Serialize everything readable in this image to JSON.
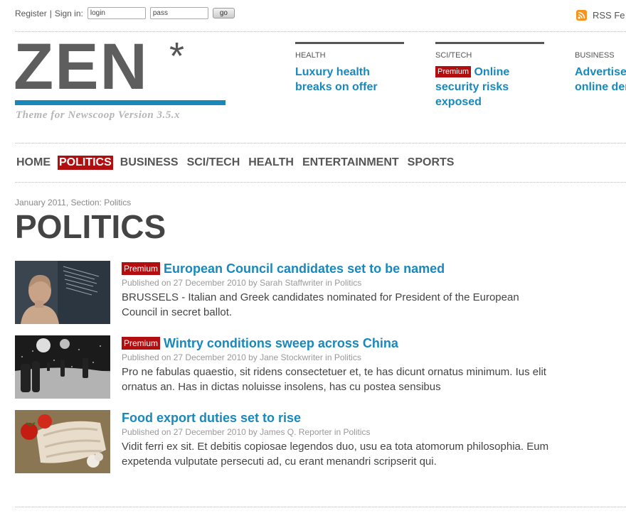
{
  "topbar": {
    "register": "Register",
    "separator": "|",
    "signin": "Sign in:",
    "login_value": "login",
    "pass_value": "pass",
    "go": "go",
    "rss": "RSS Fe"
  },
  "logo": {
    "text": "ZEN",
    "star": "*",
    "tagline": "Theme for Newscoop Version 3.5.x"
  },
  "featured": [
    {
      "section": "HEALTH",
      "badge": "",
      "title": "Luxury health breaks on offer"
    },
    {
      "section": "SCI/TECH",
      "badge": "Premium",
      "title": "Online security risks exposed"
    },
    {
      "section": "BUSINESS",
      "badge": "",
      "title": "Advertise online der"
    }
  ],
  "nav": {
    "items": [
      "HOME",
      "POLITICS",
      "BUSINESS",
      "SCI/TECH",
      "HEALTH",
      "ENTERTAINMENT",
      "SPORTS"
    ],
    "active": "POLITICS"
  },
  "section": {
    "meta": "January 2011, Section: Politics",
    "title": "POLITICS"
  },
  "articles": [
    {
      "badge": "Premium",
      "title": "European Council candidates set to be named",
      "meta": "Published on 27 December 2010 by Sarah Staffwriter in Politics",
      "text": "BRUSSELS - Italian and Greek candidates nominated for President of the European Council in secret ballot."
    },
    {
      "badge": "Premium",
      "title": "Wintry conditions sweep across China",
      "meta": "Published on 27 December 2010 by Jane Stockwriter in Politics",
      "text": "Pro ne fabulas quaestio, sit ridens consectetuer et, te has dicunt ornatus minimum. Ius elit ornatus an. Has in dictas noluisse insolens, has cu postea sensibus"
    },
    {
      "badge": "",
      "title": "Food export duties set to rise",
      "meta": "Published on 27 December 2010 by James Q. Reporter in Politics",
      "text": "Vidit ferri ex sit. Et debitis copiosae legendos duo, usu ea tota atomorum philosophia. Eum expetenda vulputate persecuti ad, cu erant menandri scripserit qui."
    }
  ],
  "colors": {
    "accent_blue": "#1888bd",
    "premium_red": "#b20e10",
    "logo_bar": "#1a87bb"
  }
}
